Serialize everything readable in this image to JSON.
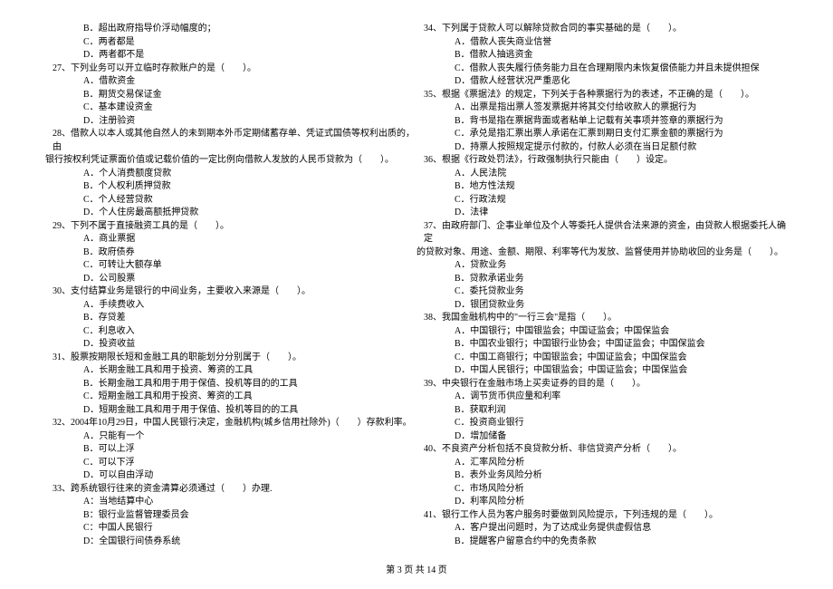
{
  "left": [
    {
      "cls": "opt",
      "k": "l0",
      "t": "B．超出政府指导价浮动幅度的；"
    },
    {
      "cls": "opt",
      "k": "l1",
      "t": "C．两者都是"
    },
    {
      "cls": "opt",
      "k": "l2",
      "t": "D．两者都不是"
    },
    {
      "cls": "q",
      "k": "l3",
      "t": "27、下列业务可以开立临时存款账户的是（　　）。"
    },
    {
      "cls": "opt",
      "k": "l4",
      "t": "A．借款资金"
    },
    {
      "cls": "opt",
      "k": "l5",
      "t": "B．期货交易保证金"
    },
    {
      "cls": "opt",
      "k": "l6",
      "t": "C．基本建设资金"
    },
    {
      "cls": "opt",
      "k": "l7",
      "t": "D．注册验资"
    },
    {
      "cls": "q",
      "k": "l8",
      "t": "28、借款人以本人或其他自然人的未到期本外币定期储蓄存单、凭证式国债等权利出质的，由"
    },
    {
      "cls": "qwrap",
      "k": "l8b",
      "t": "银行按权利凭证票面价值或记载价值的一定比例向借款人发放的人民币贷款为（　　）。"
    },
    {
      "cls": "opt",
      "k": "l9",
      "t": "A．个人消费额度贷款"
    },
    {
      "cls": "opt",
      "k": "l10",
      "t": "B．个人权利质押贷款"
    },
    {
      "cls": "opt",
      "k": "l11",
      "t": "C．个人经营贷款"
    },
    {
      "cls": "opt",
      "k": "l12",
      "t": "D．个人住房最高额抵押贷款"
    },
    {
      "cls": "q",
      "k": "l13",
      "t": "29、下列不属于直接融资工具的是（　　）。"
    },
    {
      "cls": "opt",
      "k": "l14",
      "t": "A．商业票据"
    },
    {
      "cls": "opt",
      "k": "l15",
      "t": "B．政府债券"
    },
    {
      "cls": "opt",
      "k": "l16",
      "t": "C．可转让大额存单"
    },
    {
      "cls": "opt",
      "k": "l17",
      "t": "D．公司股票"
    },
    {
      "cls": "q",
      "k": "l18",
      "t": "30、支付结算业务是银行的中间业务，主要收入来源是（　　）。"
    },
    {
      "cls": "opt",
      "k": "l19",
      "t": "A．手续费收入"
    },
    {
      "cls": "opt",
      "k": "l20",
      "t": "B．存贷差"
    },
    {
      "cls": "opt",
      "k": "l21",
      "t": "C．利息收入"
    },
    {
      "cls": "opt",
      "k": "l22",
      "t": "D．投资收益"
    },
    {
      "cls": "q",
      "k": "l23",
      "t": "31、股票按期限长短和金融工具的职能划分分别属于（　　）。"
    },
    {
      "cls": "opt",
      "k": "l24",
      "t": "A．长期金融工具和用于投资、筹资的工具"
    },
    {
      "cls": "opt",
      "k": "l25",
      "t": "B．长期金融工具和用于用于保值、投机等目的的工具"
    },
    {
      "cls": "opt",
      "k": "l26",
      "t": "C．短期金融工具和用于投资、筹资的工具"
    },
    {
      "cls": "opt",
      "k": "l27",
      "t": "D．短期金融工具和用于用于保值、投机等目的的工具"
    },
    {
      "cls": "q",
      "k": "l28",
      "t": "32、2004年10月29日，中国人民银行决定，金融机构(城乡信用社除外)（　　）存款利率。"
    },
    {
      "cls": "opt",
      "k": "l29",
      "t": "A．只能有一个"
    },
    {
      "cls": "opt",
      "k": "l30",
      "t": "B．可以上浮"
    },
    {
      "cls": "opt",
      "k": "l31",
      "t": "C．可以下浮"
    },
    {
      "cls": "opt",
      "k": "l32",
      "t": "D．可以自由浮动"
    },
    {
      "cls": "q",
      "k": "l33",
      "t": "33、跨系统银行往来的资金清算必须通过（　　）办理."
    },
    {
      "cls": "opt",
      "k": "l34",
      "t": "A：当地结算中心"
    },
    {
      "cls": "opt",
      "k": "l35",
      "t": "B：银行业监督管理委员会"
    },
    {
      "cls": "opt",
      "k": "l36",
      "t": "C：中国人民银行"
    },
    {
      "cls": "opt",
      "k": "l37",
      "t": "D：全国银行间债券系统"
    }
  ],
  "right": [
    {
      "cls": "q",
      "k": "r0",
      "t": "34、下列属于贷款人可以解除贷款合同的事实基础的是（　　）。"
    },
    {
      "cls": "opt",
      "k": "r1",
      "t": "A．借款人丧失商业信誉"
    },
    {
      "cls": "opt",
      "k": "r2",
      "t": "B．借款人抽逃资金"
    },
    {
      "cls": "opt",
      "k": "r3",
      "t": "C．借款人丧失履行债务能力且在合理期限内未恢复偿债能力并且未提供担保"
    },
    {
      "cls": "opt",
      "k": "r4",
      "t": "D．借款人经营状况严重恶化"
    },
    {
      "cls": "q",
      "k": "r5",
      "t": "35、根据《票据法》的规定，下列关于各种票据行为的表述，不正确的是（　　）。"
    },
    {
      "cls": "opt",
      "k": "r6",
      "t": "A．出票是指出票人签发票据并将其交付给收款人的票据行为"
    },
    {
      "cls": "opt",
      "k": "r7",
      "t": "B．背书是指在票据背面或者粘单上记载有关事项并签章的票据行为"
    },
    {
      "cls": "opt",
      "k": "r8",
      "t": "C．承兑是指汇票出票人承诺在汇票到期日支付汇票金额的票据行为"
    },
    {
      "cls": "opt",
      "k": "r9",
      "t": "D．持票人按照规定提示付款的，付款人必须在当日足额付款"
    },
    {
      "cls": "q",
      "k": "r10",
      "t": "36、根据《行政处罚法》，行政强制执行只能由（　　）设定。"
    },
    {
      "cls": "opt",
      "k": "r11",
      "t": "A．人民法院"
    },
    {
      "cls": "opt",
      "k": "r12",
      "t": "B．地方性法规"
    },
    {
      "cls": "opt",
      "k": "r13",
      "t": "C．行政法规"
    },
    {
      "cls": "opt",
      "k": "r14",
      "t": "D．法律"
    },
    {
      "cls": "q",
      "k": "r15",
      "t": "37、由政府部门、企事业单位及个人等委托人提供合法来源的资金，由贷款人根据委托人确定"
    },
    {
      "cls": "qwrap",
      "k": "r15b",
      "t": "的贷款对象、用途、金额、期限、利率等代为发放、监督使用并协助收回的业务是（　　）。"
    },
    {
      "cls": "opt",
      "k": "r16",
      "t": "A．贷款业务"
    },
    {
      "cls": "opt",
      "k": "r17",
      "t": "B．贷款承诺业务"
    },
    {
      "cls": "opt",
      "k": "r18",
      "t": "C．委托贷款业务"
    },
    {
      "cls": "opt",
      "k": "r19",
      "t": "D．银团贷款业务"
    },
    {
      "cls": "q",
      "k": "r20",
      "t": "38、我国金融机构中的\"一行三会\"是指（　　）。"
    },
    {
      "cls": "opt",
      "k": "r21",
      "t": "A．中国银行；中国银监会；中国证监会；中国保监会"
    },
    {
      "cls": "opt",
      "k": "r22",
      "t": "B．中国农业银行；中国银行业协会；中国证监会；中国保监会"
    },
    {
      "cls": "opt",
      "k": "r23",
      "t": "C．中国工商银行；中国银监会；中国证监会；中国保监会"
    },
    {
      "cls": "opt",
      "k": "r24",
      "t": "D．中国人民银行；中国银监会；中国证监会；中国保监会"
    },
    {
      "cls": "q",
      "k": "r25",
      "t": "39、中央银行在金融市场上买卖证券的目的是（　　）。"
    },
    {
      "cls": "opt",
      "k": "r26",
      "t": "A．调节货币供应量和利率"
    },
    {
      "cls": "opt",
      "k": "r27",
      "t": "B．获取利润"
    },
    {
      "cls": "opt",
      "k": "r28",
      "t": "C．投资商业银行"
    },
    {
      "cls": "opt",
      "k": "r29",
      "t": "D．增加储备"
    },
    {
      "cls": "q",
      "k": "r30",
      "t": "40、不良资产分析包括不良贷款分析、非信贷资产分析（　　）。"
    },
    {
      "cls": "opt",
      "k": "r31",
      "t": "A．汇率风险分析"
    },
    {
      "cls": "opt",
      "k": "r32",
      "t": "B．表外业务风险分析"
    },
    {
      "cls": "opt",
      "k": "r33",
      "t": "C．市场风险分析"
    },
    {
      "cls": "opt",
      "k": "r34",
      "t": "D．利率风险分析"
    },
    {
      "cls": "q",
      "k": "r35",
      "t": "41、银行工作人员为客户服务时要做到风险提示，下列违规的是（　　）。"
    },
    {
      "cls": "opt",
      "k": "r36",
      "t": "A．客户提出问题时，为了达成业务提供虚假信息"
    },
    {
      "cls": "opt",
      "k": "r37",
      "t": "B．提醒客户留意合约中的免责条款"
    }
  ],
  "footer": "第 3 页 共 14 页"
}
